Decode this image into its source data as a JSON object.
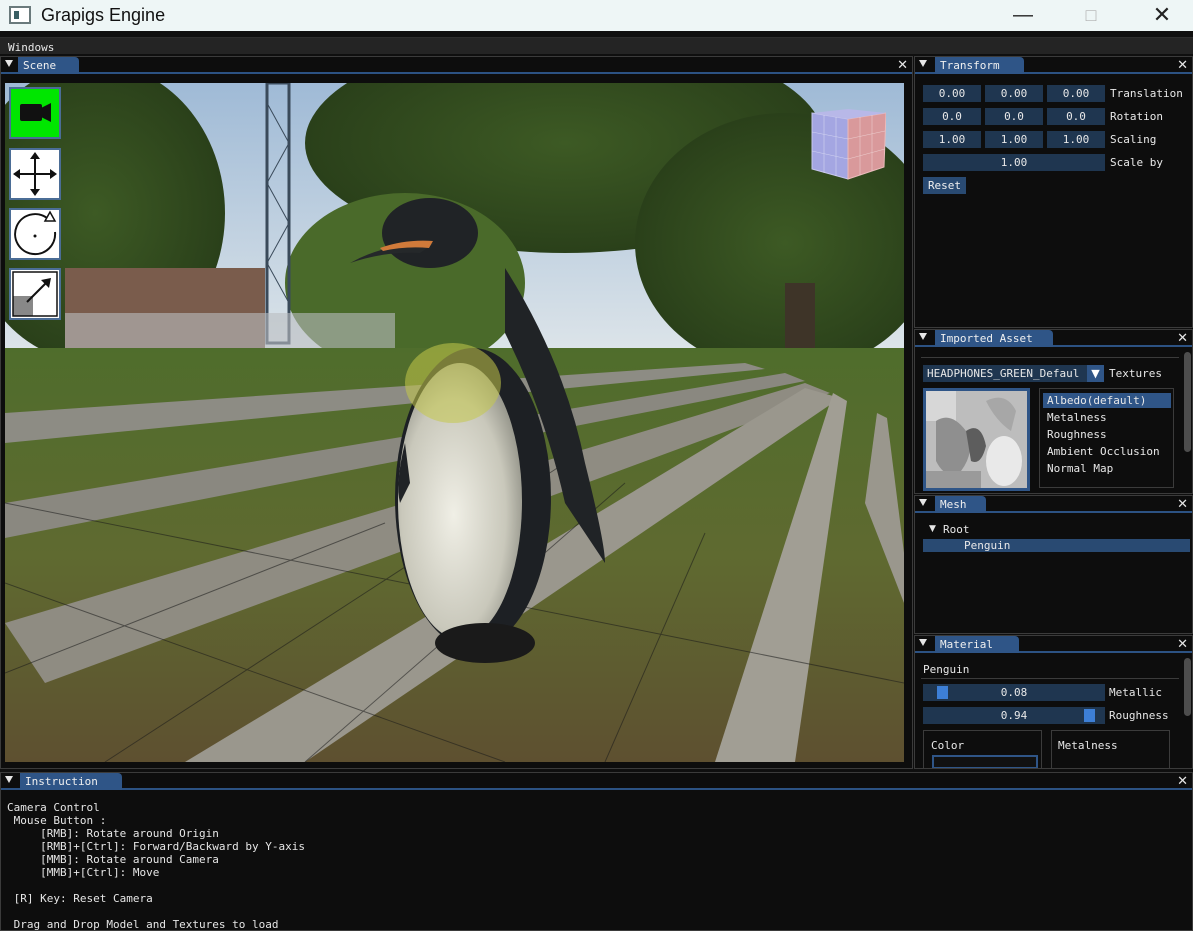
{
  "window": {
    "title": "Grapigs Engine"
  },
  "menu": {
    "windows": "Windows"
  },
  "scene": {
    "tab": "Scene"
  },
  "transform": {
    "tab": "Transform",
    "translation": {
      "x": "0.00",
      "y": "0.00",
      "z": "0.00",
      "label": "Translation"
    },
    "rotation": {
      "x": "0.0",
      "y": "0.0",
      "z": "0.0",
      "label": "Rotation"
    },
    "scaling": {
      "x": "1.00",
      "y": "1.00",
      "z": "1.00",
      "label": "Scaling"
    },
    "scale_by": {
      "value": "1.00",
      "label": "Scale by"
    },
    "reset": "Reset"
  },
  "imported_asset": {
    "tab": "Imported Asset",
    "selected": "HEADPHONES_GREEN_Defaul",
    "textures_label": "Textures",
    "texture_list": [
      "Albedo(default)",
      "Metalness",
      "Roughness",
      "Ambient Occlusion",
      "Normal Map"
    ]
  },
  "mesh": {
    "tab": "Mesh",
    "root": "Root",
    "child": "Penguin"
  },
  "material": {
    "tab": "Material",
    "name": "Penguin",
    "metallic": {
      "value": "0.08",
      "label": "Metallic",
      "fraction": 0.08
    },
    "roughness": {
      "value": "0.94",
      "label": "Roughness",
      "fraction": 0.94
    },
    "color_label": "Color",
    "metalness_label": "Metalness"
  },
  "instruction": {
    "tab": "Instruction",
    "lines": [
      "Camera Control",
      " Mouse Button :",
      "     [RMB]: Rotate around Origin",
      "     [RMB]+[Ctrl]: Forward/Backward by Y-axis",
      "     [MMB]: Rotate around Camera",
      "     [MMB]+[Ctrl]: Move",
      "",
      " [R] Key: Reset Camera",
      "",
      " Drag and Drop Model and Textures to load"
    ]
  },
  "colors": {
    "accent": "#2f5587",
    "field": "#1f3650",
    "camera_active": "#00e600"
  }
}
